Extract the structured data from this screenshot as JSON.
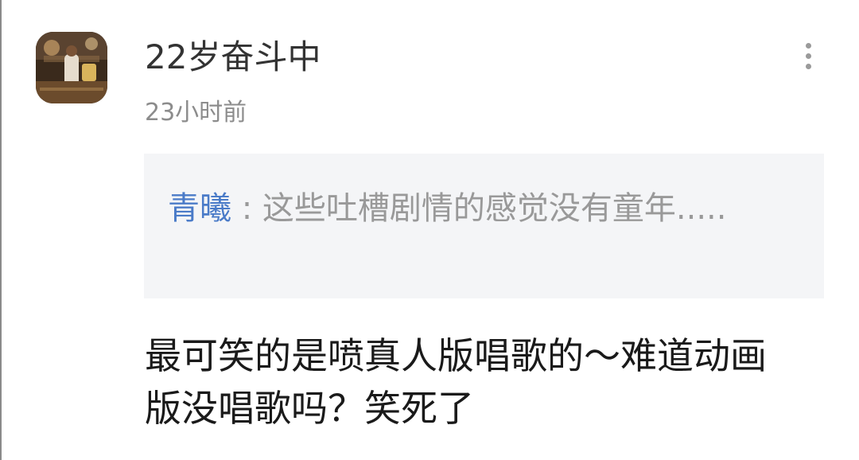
{
  "comment": {
    "username": "22岁奋斗中",
    "timestamp": "23小时前",
    "more_icon": "more-vertical-icon",
    "avatar_icon": "user-avatar-image",
    "quote": {
      "author": "青曦",
      "separator": " : ",
      "text": "这些吐槽剧情的感觉没有童年....."
    },
    "body": "最可笑的是喷真人版唱歌的～难道动画版没唱歌吗？笑死了"
  },
  "colors": {
    "background": "#ffffff",
    "quote_background": "#f4f5f7",
    "quote_author": "#4a7bc8",
    "username": "#333333",
    "muted_text": "#8c8c8c",
    "body_text": "#1a1a1a"
  }
}
